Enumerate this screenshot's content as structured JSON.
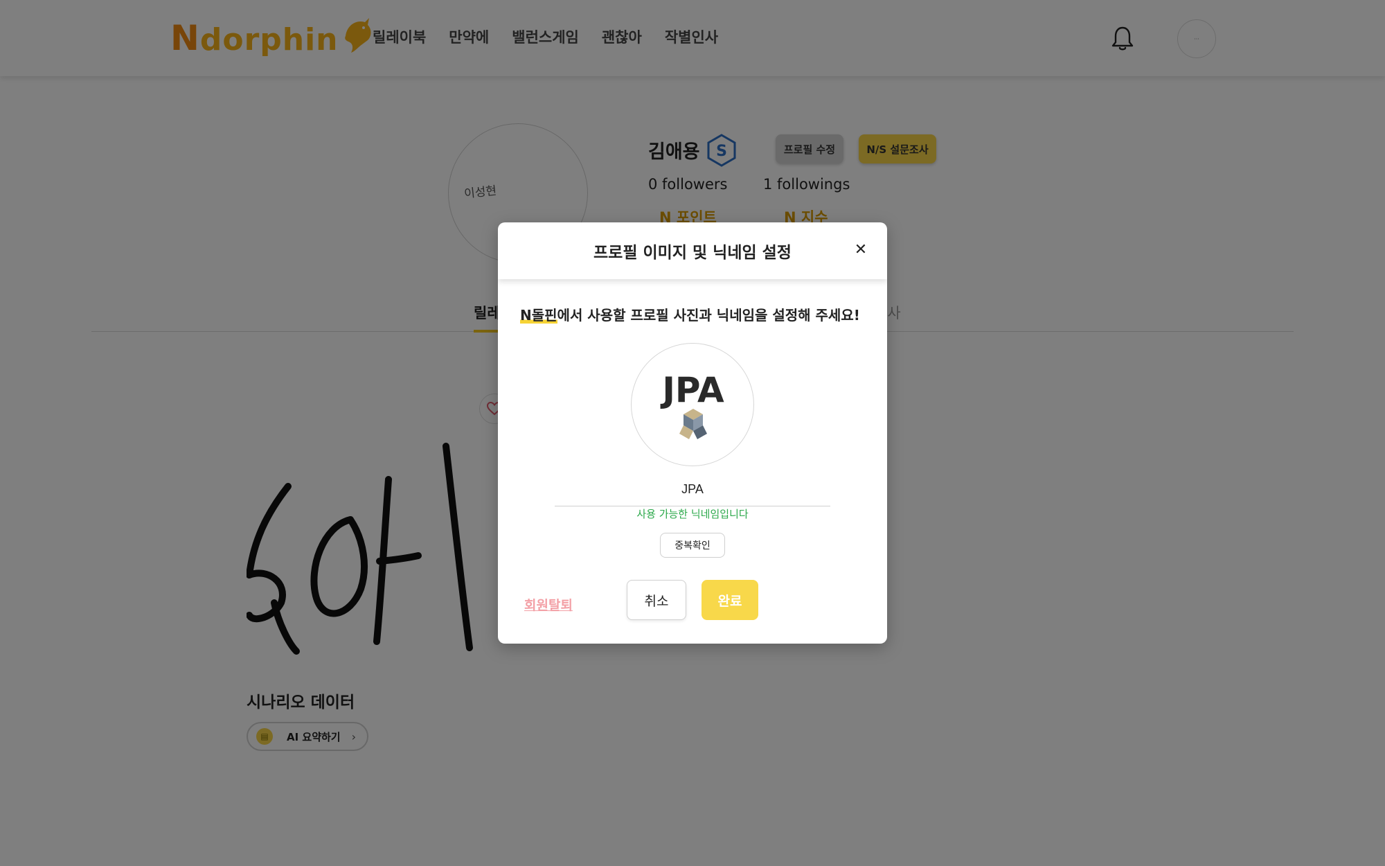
{
  "header": {
    "logo_text_cap": "N",
    "logo_text_rest": "dorphin",
    "nav": [
      "릴레이북",
      "만약에",
      "밸런스게임",
      "괜찮아",
      "작별인사"
    ],
    "bell_icon": "bell-icon",
    "avatar_text": "···"
  },
  "profile": {
    "avatar_signature": "이성현",
    "name": "김애용",
    "rank_badge": "S",
    "edit_button": "프로필 수정",
    "survey_button": "N/S 설문조사",
    "followers": "0 followers",
    "followings": "1 followings",
    "n_point_label": "N 포인트",
    "n_index_label": "N 지수"
  },
  "tabs": {
    "active_partial": "릴레",
    "right_partial": "인사"
  },
  "content": {
    "title": "시나리오 데이터",
    "ai_button": "AI 요약하기"
  },
  "modal": {
    "title": "프로필 이미지 및 닉네임 설정",
    "close_icon": "close-icon",
    "desc_highlight": "N돌핀",
    "desc_rest": "에서 사용할 프로필 사진과 닉네임을 설정해 주세요!",
    "avatar_image_text": "JPA",
    "nickname_value": "JPA",
    "nickname_status": "사용 가능한 닉네임입니다",
    "duplicate_check": "중복확인",
    "withdraw": "회원탈퇴",
    "cancel": "취소",
    "done": "완료"
  },
  "colors": {
    "accent_yellow": "#f8d84a",
    "logo_orange": "#f08a12",
    "logo_yellow": "#f6b21a",
    "success_green": "#2ba84a",
    "withdraw_pink": "#f3a0a6",
    "point_gold": "#d99a00"
  }
}
